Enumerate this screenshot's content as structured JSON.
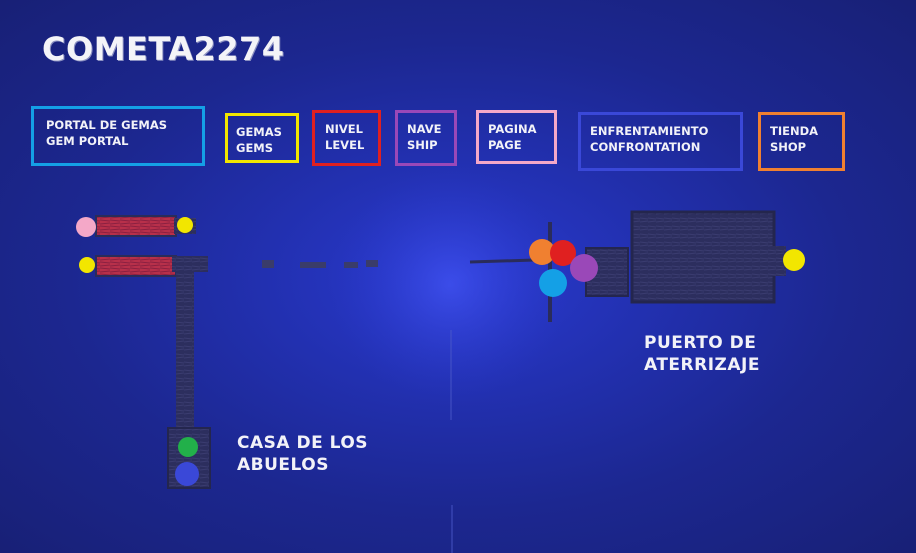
{
  "game": {
    "title": "COMETA2274"
  },
  "legend": [
    {
      "line1": "PORTAL DE GEMAS",
      "line2": "GEM PORTAL",
      "color": "#14a0e6"
    },
    {
      "line1": "GEMAS",
      "line2": "GEMS",
      "color": "#f2e600"
    },
    {
      "line1": "NIVEL",
      "line2": "LEVEL",
      "color": "#e02020"
    },
    {
      "line1": "NAVE",
      "line2": "SHIP",
      "color": "#9a48b8"
    },
    {
      "line1": "PAGINA",
      "line2": "PAGE",
      "color": "#f4a8c8"
    },
    {
      "line1": "ENFRENTAMIENTO",
      "line2": "CONFRONTATION",
      "color": "#3a48d8"
    },
    {
      "line1": "TIENDA",
      "line2": "SHOP",
      "color": "#f08030"
    }
  ],
  "locations": {
    "grandparents_house": {
      "line1": "CASA DE LOS",
      "line2": "ABUELOS"
    },
    "landing_port": {
      "line1": "PUERTO DE",
      "line2": "ATERRIZAJE"
    }
  },
  "colors": {
    "path_dark": "#2a2c5a",
    "path_red": "#b8304a",
    "node_pink": "#f4a8c8",
    "node_yellow": "#f2e600",
    "node_green": "#22b04a",
    "node_blue": "#3a48d8",
    "node_orange": "#f08030",
    "node_red": "#e02020",
    "node_purple": "#9a48b8",
    "node_cyan": "#14a0e6"
  }
}
